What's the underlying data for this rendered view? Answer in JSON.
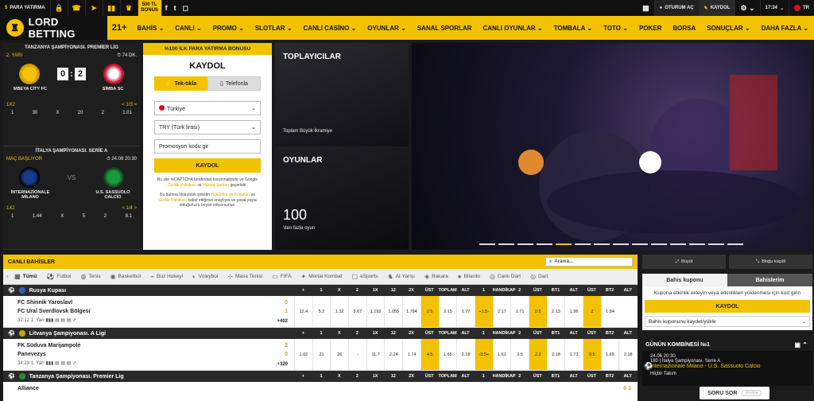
{
  "topbar": {
    "deposit": "PARA YATIRMA",
    "bonus_amount": "500 TL",
    "bonus_word": "BONUS",
    "login": "OTURUM AÇ",
    "register": "KAYDOL",
    "time": "17:34",
    "lang": "TR"
  },
  "nav": {
    "logo": "LORD BETTING",
    "plus": "21+",
    "items": [
      "BAHİS ⌄",
      "CANLI ⌄",
      "PROMO ⌄",
      "SLOTLAR ⌄",
      "CANLI CASİNO ⌄",
      "OYUNLAR ⌄",
      "SANAL SPORLAR",
      "CANLI OYUNLAR ⌄",
      "TOMBALA ⌄",
      "TOTO ⌄",
      "POKER",
      "BORSA",
      "SONUÇLAR ⌄",
      "DAHA FAZLA ⌄"
    ]
  },
  "match1": {
    "league": "TANZANYA ŞAMPİYONASI. PREMİER LİG",
    "state": "2. YARI",
    "minute": "74 DK.",
    "score_home": "0",
    "score_away": "2",
    "home": "MBEYA CİTY FC",
    "away": "SİMBA SC",
    "type": "1X2",
    "more": "< 1/3 >",
    "odds": [
      "1",
      "30",
      "X",
      "20",
      "2",
      "1.01"
    ]
  },
  "match2": {
    "league": "İTALYA ŞAMPİYONASI. SERİE A",
    "state": "MAÇ BAŞLIYOR",
    "time": "24.06 20:30",
    "vs": "VS",
    "home": "İNTERNAZİONALE MİLANO",
    "away": "U.S. SASSUOLO CALCİO",
    "type": "1X2",
    "more": "< 1/4 >",
    "odds": [
      "1",
      "1.44",
      "X",
      "5",
      "2",
      "8.1"
    ]
  },
  "form": {
    "bonus_strip": "%100 İLK PARA YATIRMA BONUSU",
    "title": "KAYDOL",
    "tab1": "Tek-tıkla",
    "tab2": "Telefonla",
    "country": "Türkiye",
    "currency": "TRY (Türk lirası)",
    "promo_placeholder": "Promosyon kodu gir",
    "button": "KAYDOL",
    "legal1a": "Bu site reCAPTCHA tarafından korunmaktadır ve Google ",
    "legal1_link1": "Gizlilik Politikası",
    "legal1b": " ve ",
    "legal1_link2": "Hizmet Şartları",
    "legal1c": " geçerlidir.",
    "legal2a": "Bu butona tıklayarak şirketin ",
    "legal2_link1": "Hükümler ve Koşulları",
    "legal2b": " ve ",
    "legal2_link2": "Gizlilik Politikası",
    "legal2c": " kabul ettiğinizi onaylıyor ve yasal yaşta olduğunuzu beyan ediyorsunuz."
  },
  "promo": {
    "title1": "TOPLAYICILAR",
    "sub1": "Toplam Büyük İkramiye",
    "title2": "OYUNLAR",
    "big": "100",
    "sub2": "'den fazla oyun"
  },
  "hero": {
    "dot_count": 14,
    "active_index": 4
  },
  "live": {
    "title": "CANLI BAHİSLER",
    "search_placeholder": "Arama...",
    "sports": [
      {
        "icon": "▦",
        "label": "Tümü"
      },
      {
        "icon": "⚽",
        "label": "Futbol"
      },
      {
        "icon": "◍",
        "label": "Tenis"
      },
      {
        "icon": "◉",
        "label": "Basketbol"
      },
      {
        "icon": "⌁",
        "label": "Buz Hokeyi"
      },
      {
        "icon": "◐",
        "label": "Voleybol"
      },
      {
        "icon": "⊹",
        "label": "Masa Tenisi"
      },
      {
        "icon": "▭",
        "label": "FIFA"
      },
      {
        "icon": "✦",
        "label": "Mortal Kombat"
      },
      {
        "icon": "▢",
        "label": "eSports"
      },
      {
        "icon": "♞",
        "label": "At Yarışı"
      },
      {
        "icon": "◈",
        "label": "Bakara"
      },
      {
        "icon": "●",
        "label": "Bilardo"
      },
      {
        "icon": "◎",
        "label": "Canlı Dart"
      },
      {
        "icon": "◎",
        "label": "Dart"
      }
    ],
    "columns": [
      "+",
      "1",
      "X",
      "2",
      "1X",
      "12",
      "2X",
      "ÜST",
      "TOPLAM",
      "ALT",
      "1",
      "HANDİKAP",
      "2",
      "ÜST",
      "BT1",
      "ALT",
      "ÜST",
      "BT2",
      "ALT"
    ],
    "leagues": [
      {
        "name": "Rusya Kupası",
        "flag": "#2d5fb8",
        "event": {
          "home": "FC Shinnik Yaroslavl",
          "away": "FC Ural Sverdlovsk Bölgesi",
          "score_home": "0",
          "score_away": "1",
          "time": "32:12",
          "half": "1. Yarı",
          "more": "+402",
          "odds": [
            "12.4",
            "5.2",
            "1.32",
            "3.67",
            "1.192",
            "1.055",
            "1.784",
            "2.5",
            "2.15",
            "1.77",
            "+1.5-",
            "2.17",
            "1.71",
            "0.5",
            "2.13",
            "1.96",
            "2",
            "1.84"
          ]
        }
      },
      {
        "name": "Litvanya Şampiyonası. A Ligi",
        "flag": "#c8a800",
        "event": {
          "home": "FK Süduva Marijampolė",
          "away": "Panevezys",
          "score_home": "2",
          "score_away": "0",
          "time": "34:23",
          "half": "1. Yarı",
          "more": "+320",
          "odds": [
            "1.02",
            "21",
            "26",
            "-",
            "11.7",
            "2.24",
            "1.74",
            "4.5",
            "1.65",
            "2.18",
            "-3.5+",
            "1.61",
            "3.5",
            "2.2",
            "2.18",
            "1.73",
            "0.5",
            "1.65",
            "2.18"
          ]
        }
      },
      {
        "name": "Tanzanya Şampiyonası. Premier Lig",
        "flag": "#2a8a3a",
        "event": {
          "home": "Alliance",
          "score_home": "0",
          "score_away": "1"
        }
      }
    ]
  },
  "right": {
    "btn1": "Büyüt",
    "btn2": "Bloğu küçült",
    "tab1": "Bahis kuponu",
    "tab2": "Bahislerim",
    "msg": "Kupona etkinlik ekleyin veya etkinlikleri yüklenmesi için kod girin",
    "kaydol": "KAYDOL",
    "save": "Bahis kuponunu kaydet/yükle",
    "combo_title": "GÜNÜN KOMBİNESİ №1",
    "combo_time": "24.06 20:30",
    "combo_league": "180 | İtalya Şampiyonası. Serie A",
    "combo_match": "Internazionale Milano - U.S. Sassuolo Calcio",
    "combo_more": "Hiçbir Takım",
    "help": "SORU SOR",
    "help_status": "on-line"
  }
}
